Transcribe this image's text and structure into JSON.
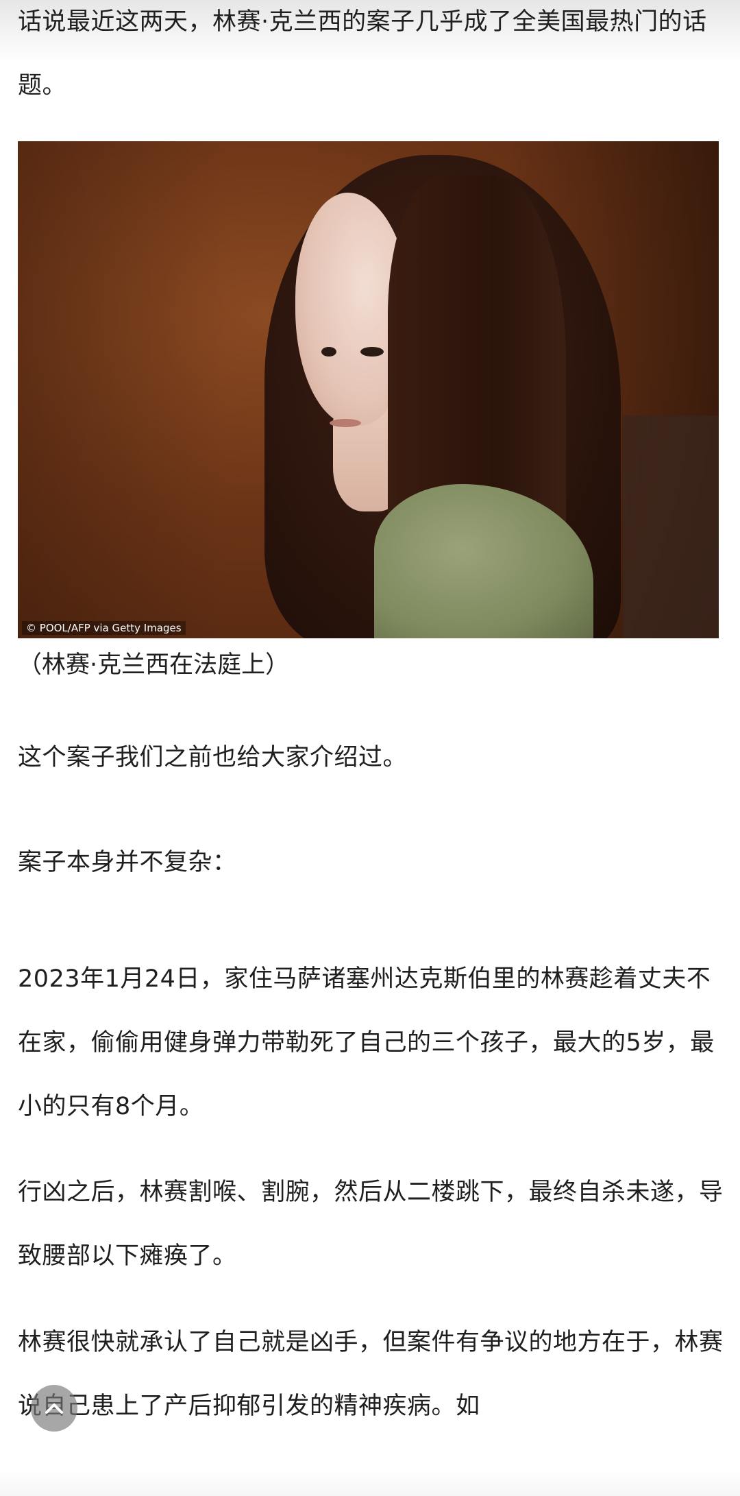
{
  "article": {
    "paragraph_intro": "话说最近这两天，林赛·克兰西的案子几乎成了全美国最热门的话题。",
    "photo": {
      "credit": "© POOL/AFP via Getty Images",
      "caption": "（林赛·克兰西在法庭上）"
    },
    "paragraph_1": "这个案子我们之前也给大家介绍过。",
    "paragraph_2": "案子本身并不复杂：",
    "paragraph_3": "2023年1月24日，家住马萨诸塞州达克斯伯里的林赛趁着丈夫不在家，偷偷用健身弹力带勒死了自己的三个孩子，最大的5岁，最小的只有8个月。",
    "paragraph_4": "行凶之后，林赛割喉、割腕，然后从二楼跳下，最终自杀未遂，导致腰部以下瘫痪了。",
    "paragraph_5": "林赛很快就承认了自己就是凶手，但案件有争议的地方在于，林赛说自己患上了产后抑郁引发的精神疾病。如"
  },
  "controls": {
    "scroll_top_icon": "arrow-up-icon"
  }
}
